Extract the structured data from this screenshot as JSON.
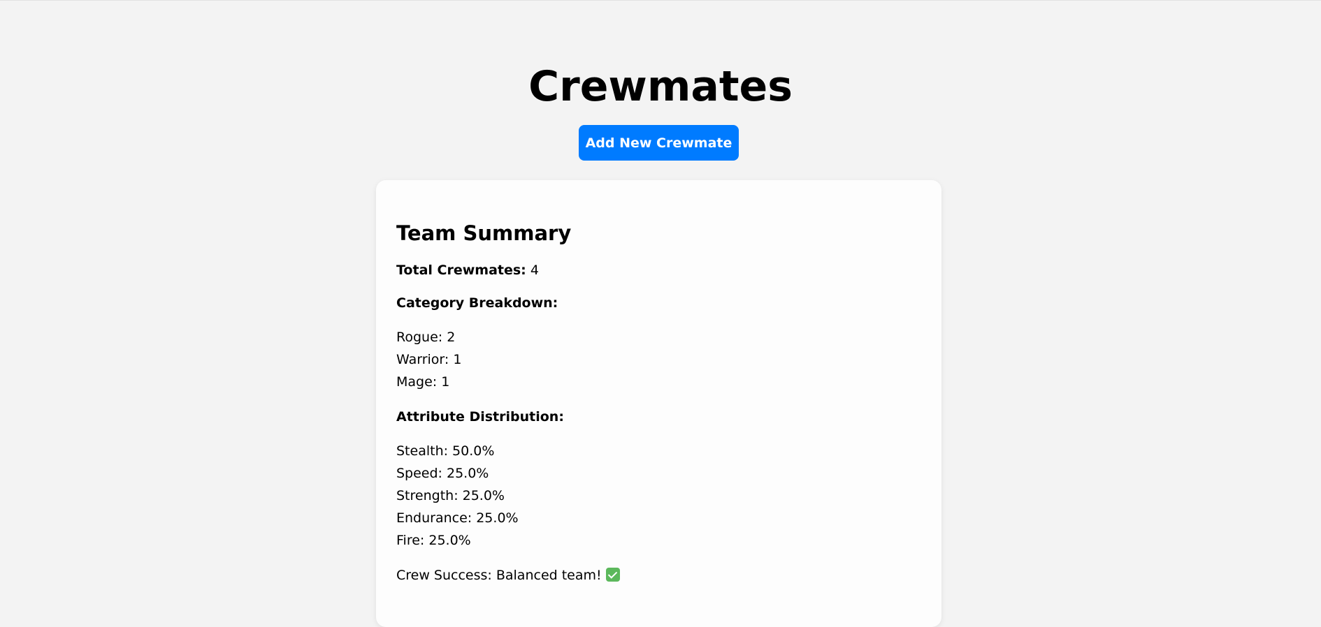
{
  "page": {
    "title": "Crewmates",
    "add_button_label": "Add New Crewmate"
  },
  "summary": {
    "heading": "Team Summary",
    "total_label": "Total Crewmates:",
    "total_value": "4",
    "category_heading": "Category Breakdown:",
    "categories": [
      {
        "name": "Rogue",
        "text": "Rogue: 2"
      },
      {
        "name": "Warrior",
        "text": "Warrior: 1"
      },
      {
        "name": "Mage",
        "text": "Mage: 1"
      }
    ],
    "attribute_heading": "Attribute Distribution:",
    "attributes": [
      {
        "name": "Stealth",
        "text": "Stealth: 50.0%"
      },
      {
        "name": "Speed",
        "text": "Speed: 25.0%"
      },
      {
        "name": "Strength",
        "text": "Strength: 25.0%"
      },
      {
        "name": "Endurance",
        "text": "Endurance: 25.0%"
      },
      {
        "name": "Fire",
        "text": "Fire: 25.0%"
      }
    ],
    "success_text": "Crew Success: Balanced team!",
    "success_icon": "check-mark-icon"
  },
  "colors": {
    "accent": "#007bff",
    "success_icon": "#5cb85c",
    "background": "#f3f3f3",
    "card": "#fdfdfd"
  }
}
